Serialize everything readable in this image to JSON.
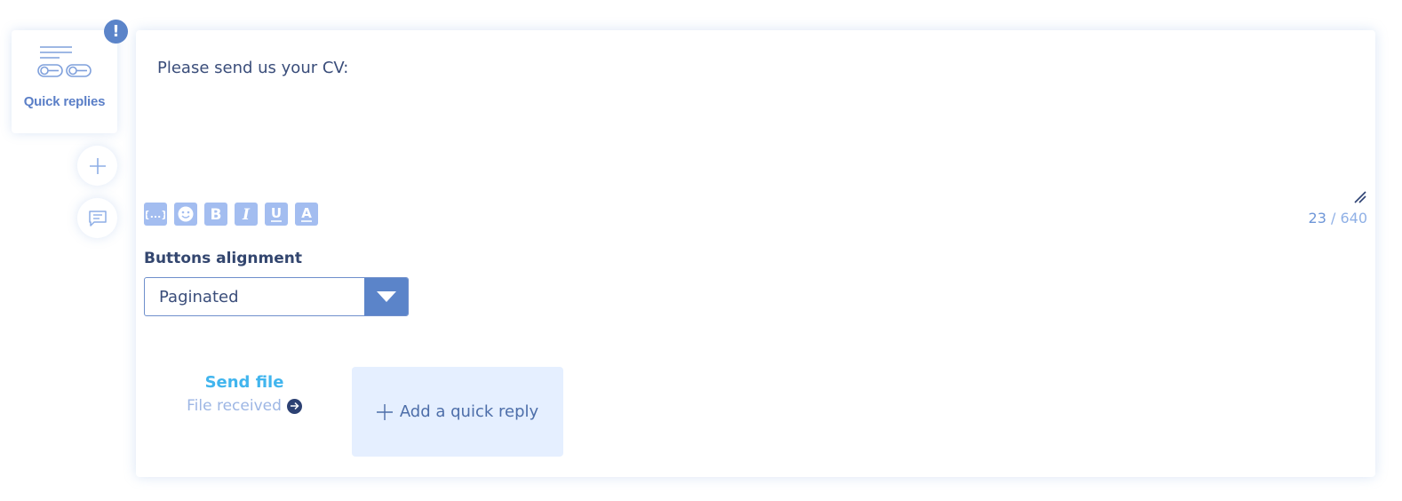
{
  "sidebar": {
    "quick_replies_label": "Quick replies",
    "alert_badge": "!",
    "icons": {
      "quick_replies": "quick-replies-icon",
      "add": "plus-icon",
      "message": "chat-bubble-icon"
    }
  },
  "editor": {
    "message": "Please send us your CV:",
    "char_count_current": "23",
    "char_count_max": "/ 640",
    "toolbar": [
      "variable-icon",
      "emoji-icon",
      "bold-icon",
      "italic-icon",
      "underline-icon",
      "text-color-icon"
    ]
  },
  "alignment": {
    "label": "Buttons alignment",
    "selected": "Paginated"
  },
  "quick_reply": {
    "title": "Send file",
    "subtitle": "File received"
  },
  "add_quick_reply": {
    "label": "Add a quick reply"
  },
  "colors": {
    "accent": "#5b84c9",
    "link": "#41b5ee",
    "tool_bg": "#a3bdf0",
    "add_bg": "#e5efff"
  }
}
